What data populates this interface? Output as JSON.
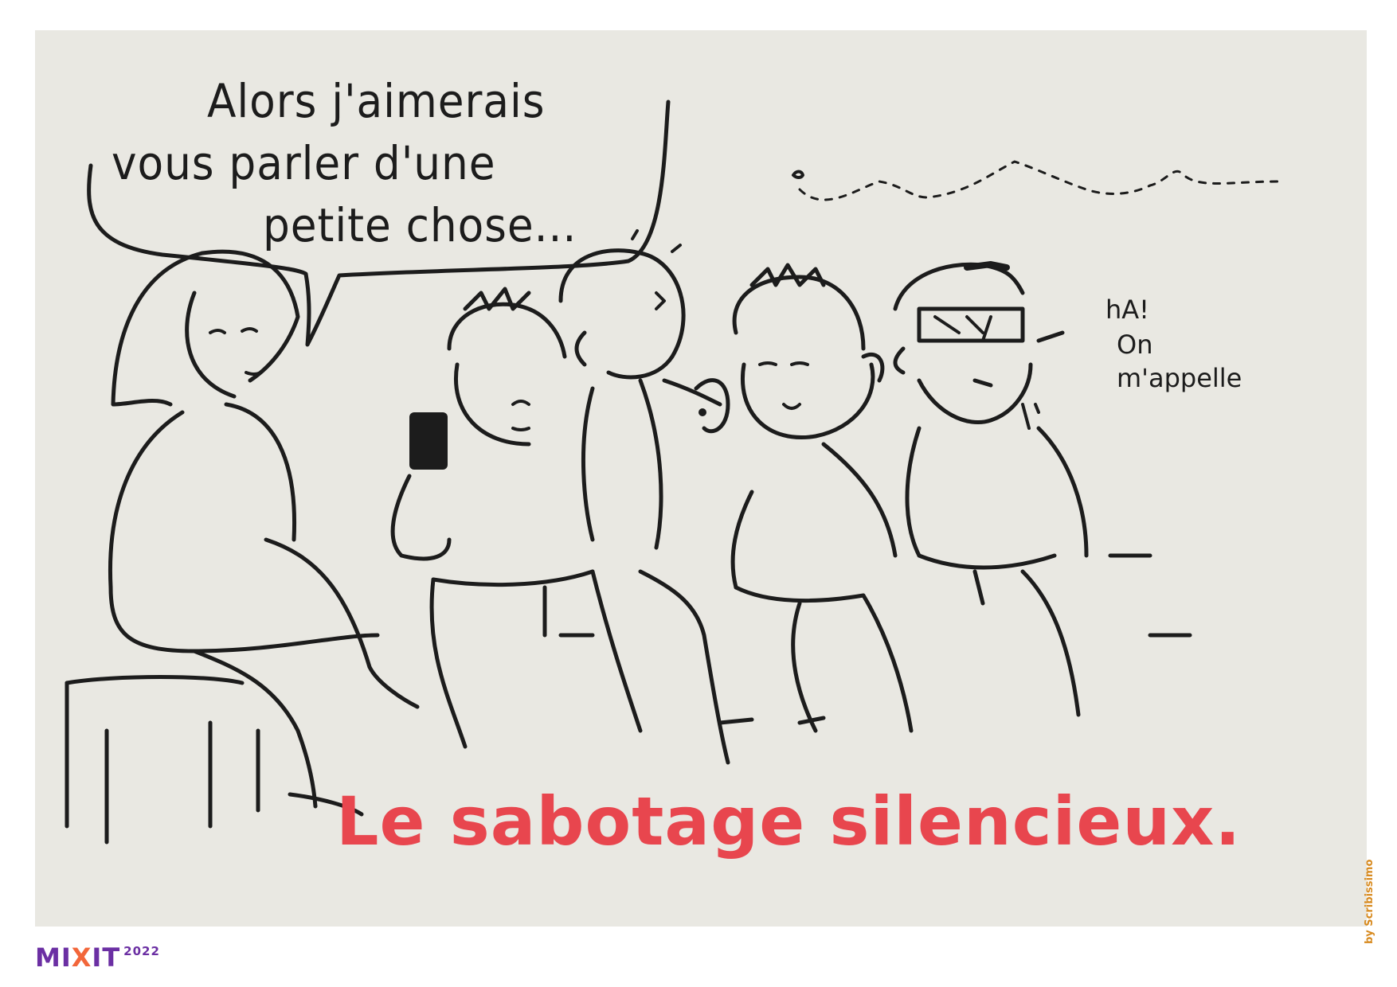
{
  "speech_bubble": {
    "lines": [
      "Alors j'aimerais",
      "vous parler d'une",
      "petite chose..."
    ]
  },
  "aside": {
    "lines": [
      "hA!",
      "On",
      "m'appelle"
    ]
  },
  "title": "Le sabotage silencieux.",
  "credit": "by Scribissimo",
  "logo": {
    "text_mix": "MI",
    "text_x": "X",
    "text_it": "IT",
    "year": "2022"
  },
  "colors": {
    "board": "#e9e8e2",
    "ink": "#1c1c1c",
    "title_red": "#e8464e",
    "logo_purple": "#6b2fa3",
    "logo_orange": "#f2663a",
    "credit_orange": "#d78a1f"
  }
}
